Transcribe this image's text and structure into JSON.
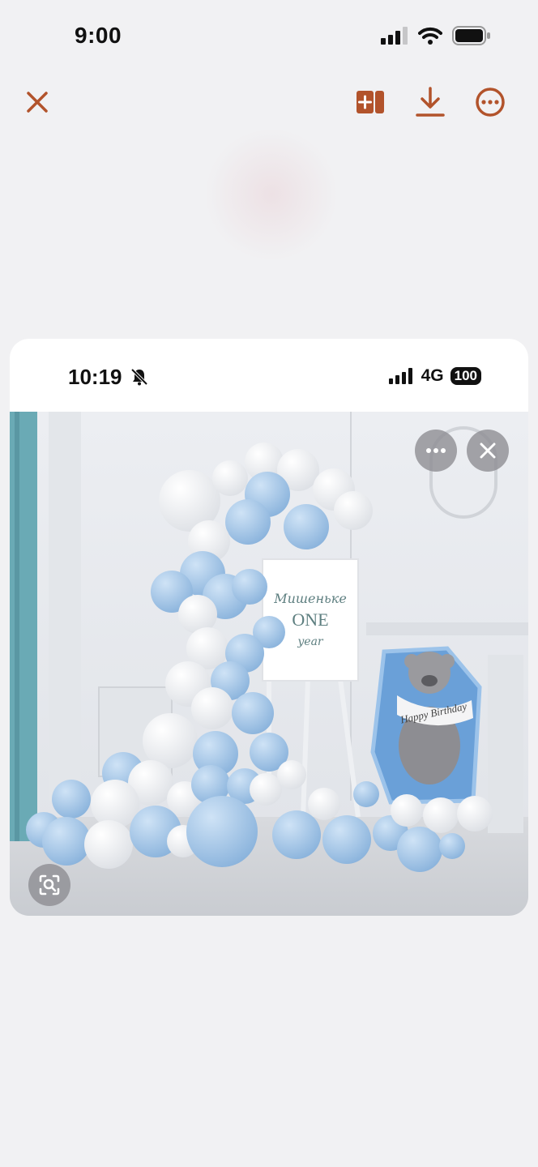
{
  "status_bar": {
    "time": "9:00",
    "icons": [
      "signal-icon",
      "wifi-icon",
      "battery-icon"
    ]
  },
  "toolbar": {
    "accent_color": "#b2532b",
    "close_icon": "close-icon",
    "actions": [
      "add-to-album-icon",
      "download-icon",
      "more-icon"
    ]
  },
  "screenshot_card": {
    "status_time": "10:19",
    "network": "4G",
    "battery": "100",
    "photo": {
      "sign_lines": [
        "Мишеньке",
        "ONE",
        "year"
      ],
      "banner_text": "Happy Birthday",
      "overlay_buttons": [
        "more-icon",
        "close-icon"
      ],
      "lens_button": "visual-lookup-icon"
    }
  }
}
